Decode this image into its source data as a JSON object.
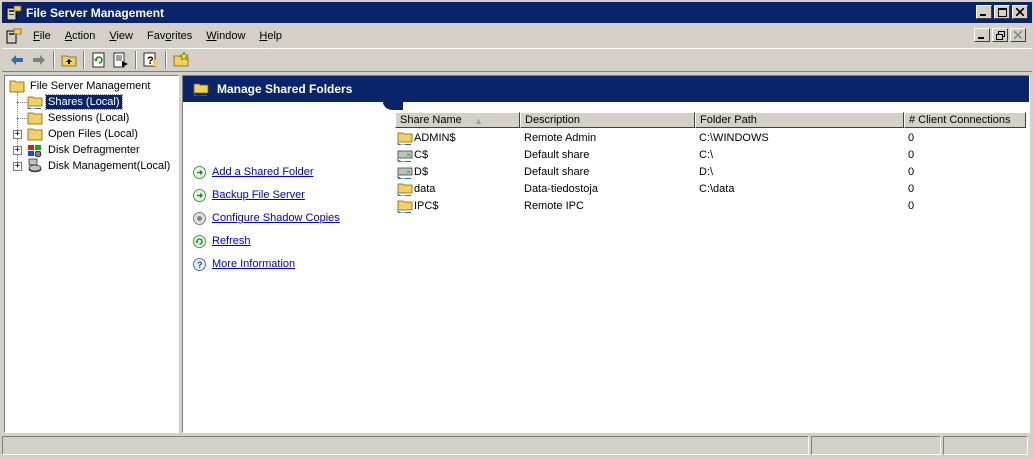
{
  "window": {
    "title": "File Server Management",
    "caption_buttons": [
      "minimize",
      "maximize",
      "close"
    ]
  },
  "menubar": {
    "items": [
      {
        "label": "File",
        "accel": "F"
      },
      {
        "label": "Action",
        "accel": "A"
      },
      {
        "label": "View",
        "accel": "V"
      },
      {
        "label": "Favorites",
        "accel": "o"
      },
      {
        "label": "Window",
        "accel": "W"
      },
      {
        "label": "Help",
        "accel": "H"
      }
    ]
  },
  "toolbar": {
    "buttons": [
      "back-arrow-icon",
      "forward-arrow-icon",
      "up-one-level-icon",
      "refresh-icon",
      "export-list-icon",
      "help-icon",
      "new-window-icon"
    ]
  },
  "tree": {
    "root": "File Server Management",
    "items": [
      {
        "label": "Shares (Local)",
        "selected": true,
        "expandable": false
      },
      {
        "label": "Sessions (Local)",
        "selected": false,
        "expandable": false
      },
      {
        "label": "Open Files (Local)",
        "selected": false,
        "expandable": true
      },
      {
        "label": "Disk Defragmenter",
        "selected": false,
        "expandable": true
      },
      {
        "label": "Disk Management(Local)",
        "selected": false,
        "expandable": true
      }
    ]
  },
  "banner": {
    "title": "Manage Shared Folders"
  },
  "actions": [
    {
      "label": "Add a Shared Folder",
      "icon": "go-arrow-icon"
    },
    {
      "label": "Backup File Server",
      "icon": "go-arrow-icon"
    },
    {
      "label": "Configure Shadow Copies",
      "icon": "settings-icon"
    },
    {
      "label": "Refresh",
      "icon": "refresh-icon"
    },
    {
      "label": "More Information",
      "icon": "help-icon"
    }
  ],
  "table": {
    "columns": [
      "Share Name",
      "Description",
      "Folder Path",
      "# Client Connections"
    ],
    "sorted_column": "Share Name",
    "rows": [
      {
        "name": "ADMIN$",
        "description": "Remote Admin",
        "path": "C:\\WINDOWS",
        "connections": "0",
        "icon": "shared-folder-icon"
      },
      {
        "name": "C$",
        "description": "Default share",
        "path": "C:\\",
        "connections": "0",
        "icon": "shared-drive-icon"
      },
      {
        "name": "D$",
        "description": "Default share",
        "path": "D:\\",
        "connections": "0",
        "icon": "shared-drive-icon"
      },
      {
        "name": "data",
        "description": "Data-tiedostoja",
        "path": "C:\\data",
        "connections": "0",
        "icon": "shared-folder-icon"
      },
      {
        "name": "IPC$",
        "description": "Remote IPC",
        "path": "",
        "connections": "0",
        "icon": "shared-folder-icon"
      }
    ]
  },
  "colors": {
    "title_bar": "#0a246a",
    "face": "#d4d0c8",
    "link": "#0000cc",
    "selection": "#0a246a"
  }
}
